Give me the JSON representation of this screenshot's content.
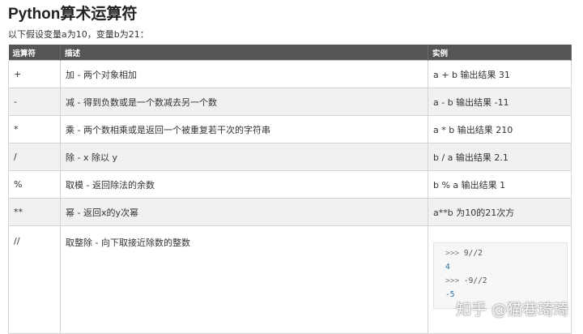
{
  "title": "Python算术运算符",
  "intro": "以下假设变量a为10，变量b为21：",
  "table": {
    "headers": [
      "运算符",
      "描述",
      "实例"
    ],
    "rows": [
      {
        "op": "+",
        "desc": "加 - 两个对象相加",
        "example": "a + b 输出结果 31"
      },
      {
        "op": "-",
        "desc": "减 - 得到负数或是一个数减去另一个数",
        "example": "a - b 输出结果 -11"
      },
      {
        "op": "*",
        "desc": "乘 - 两个数相乘或是返回一个被重复若干次的字符串",
        "example": "a * b 输出结果 210"
      },
      {
        "op": "/",
        "desc": "除 - x 除以 y",
        "example": "b / a 输出结果 2.1"
      },
      {
        "op": "%",
        "desc": "取模 - 返回除法的余数",
        "example": "b % a 输出结果 1"
      },
      {
        "op": "**",
        "desc": "幂 - 返回x的y次幂",
        "example": "a**b 为10的21次方"
      },
      {
        "op": "//",
        "desc": "取整除 - 向下取接近除数的整数",
        "example": ""
      }
    ]
  },
  "code_example": {
    "prompt": ">>>",
    "lines": [
      {
        "kind": "input",
        "text": "9//2"
      },
      {
        "kind": "output",
        "text": "4"
      },
      {
        "kind": "input",
        "text": "-9//2"
      },
      {
        "kind": "output",
        "text": "-5"
      }
    ]
  },
  "watermark": "知乎 @猫巷琦琦"
}
